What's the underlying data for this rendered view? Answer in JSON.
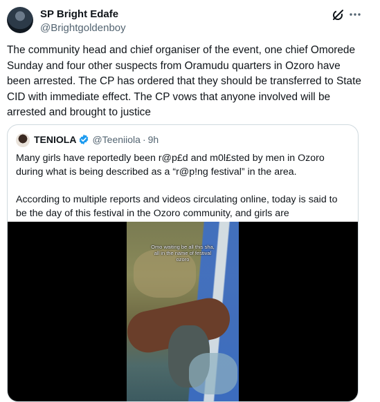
{
  "tweet": {
    "author_name": "SP Bright Edafe",
    "author_handle": "@Brightgoldenboy",
    "grok_icon": "grok-icon",
    "more_icon": "more-icon",
    "text": "The community head and chief organiser of the event, one chief Omorede Sunday and four other suspects from Oramudu quarters in Ozoro have been arrested. The CP has ordered that they should be transferred to State CID with immediate effect. The CP vows that anyone involved will be arrested and brought to justice"
  },
  "quote": {
    "name": "TENIOLA",
    "verified_icon": "verified-badge-icon",
    "handle": "@Teeniiola",
    "separator": "·",
    "time": "9h",
    "paragraph1": "Many girls have reportedly been r@p£d and m0l£sted by men in Ozoro during what is being described as a “r@p!ng festival” in the area.",
    "paragraph2": "According to multiple reports and videos circulating online, today is said to be the day of this festival in the Ozoro community, and girls are",
    "video_caption": [
      "Omo waiting be all this sha,",
      "all in the name of festival",
      "ozoro"
    ]
  },
  "colors": {
    "text": "#0f1419",
    "secondary": "#536471",
    "border": "#cfd9de",
    "verified": "#1d9bf0"
  }
}
